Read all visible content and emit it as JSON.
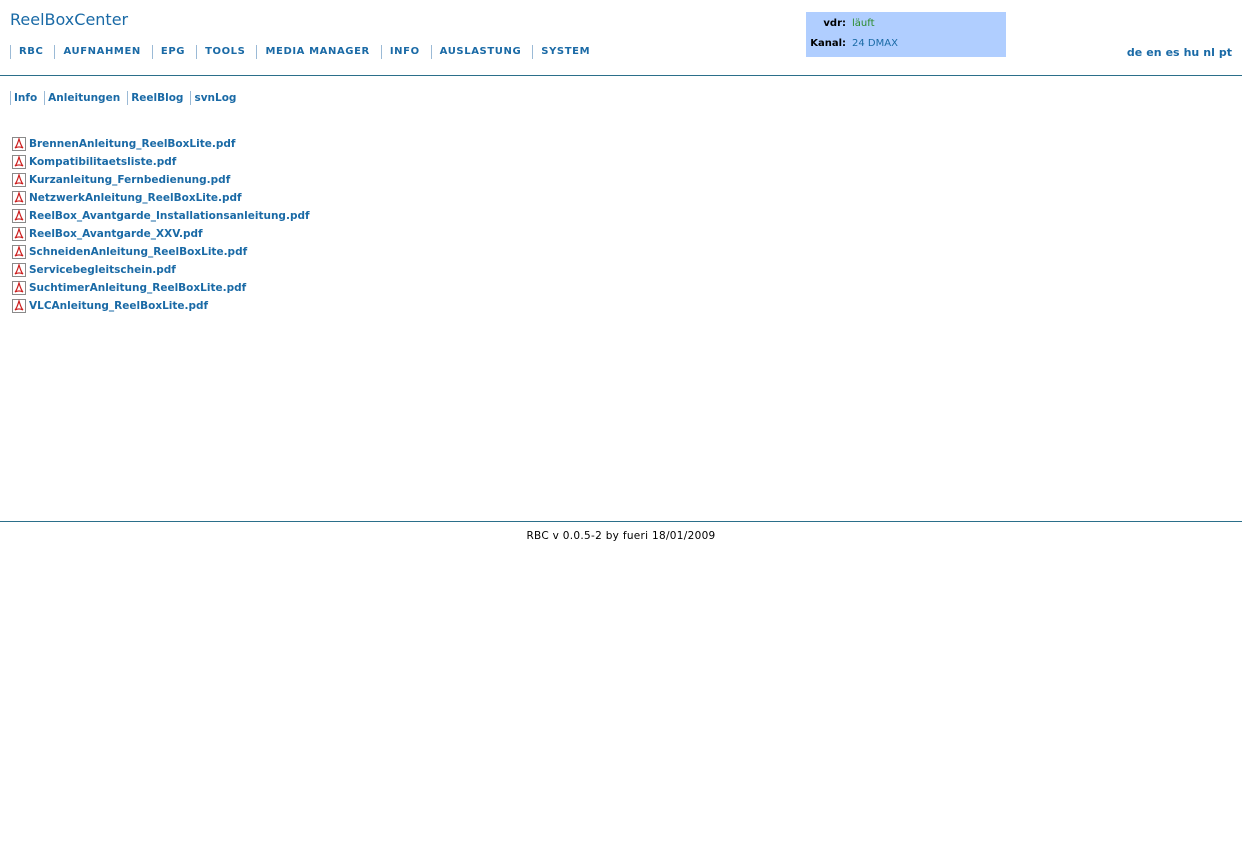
{
  "app": {
    "title": "ReelBoxCenter"
  },
  "main_nav": {
    "items": [
      "RBC",
      "AUFNAHMEN",
      "EPG",
      "TOOLS",
      "MEDIA MANAGER",
      "INFO",
      "AUSLASTUNG",
      "SYSTEM"
    ]
  },
  "status": {
    "vdr_label": "vdr:",
    "vdr_value": "läuft",
    "kanal_label": "Kanal:",
    "kanal_value": "24 DMAX",
    "box_color": "#b0ceff",
    "vdr_value_color": "#2a8a2a",
    "kanal_value_color": "#1a6aa6"
  },
  "languages": [
    "de",
    "en",
    "es",
    "hu",
    "nl",
    "pt"
  ],
  "sub_nav": {
    "items": [
      "Info",
      "Anleitungen",
      "ReelBlog",
      "svnLog"
    ]
  },
  "files": [
    {
      "name": "BrennenAnleitung_ReelBoxLite.pdf",
      "icon": "pdf-icon"
    },
    {
      "name": "Kompatibilitaetsliste.pdf",
      "icon": "pdf-icon"
    },
    {
      "name": "Kurzanleitung_Fernbedienung.pdf",
      "icon": "pdf-icon"
    },
    {
      "name": "NetzwerkAnleitung_ReelBoxLite.pdf",
      "icon": "pdf-icon"
    },
    {
      "name": "ReelBox_Avantgarde_Installationsanleitung.pdf",
      "icon": "pdf-icon"
    },
    {
      "name": "ReelBox_Avantgarde_XXV.pdf",
      "icon": "pdf-icon"
    },
    {
      "name": "SchneidenAnleitung_ReelBoxLite.pdf",
      "icon": "pdf-icon"
    },
    {
      "name": "Servicebegleitschein.pdf",
      "icon": "pdf-icon"
    },
    {
      "name": "SuchtimerAnleitung_ReelBoxLite.pdf",
      "icon": "pdf-icon"
    },
    {
      "name": "VLCAnleitung_ReelBoxLite.pdf",
      "icon": "pdf-icon"
    }
  ],
  "footer": {
    "text": "RBC v 0.0.5-2 by fueri 18/01/2009"
  },
  "colors": {
    "link": "#1a6aa6",
    "rule": "#2b6f8a",
    "nav_separator": "#9bbad6"
  }
}
